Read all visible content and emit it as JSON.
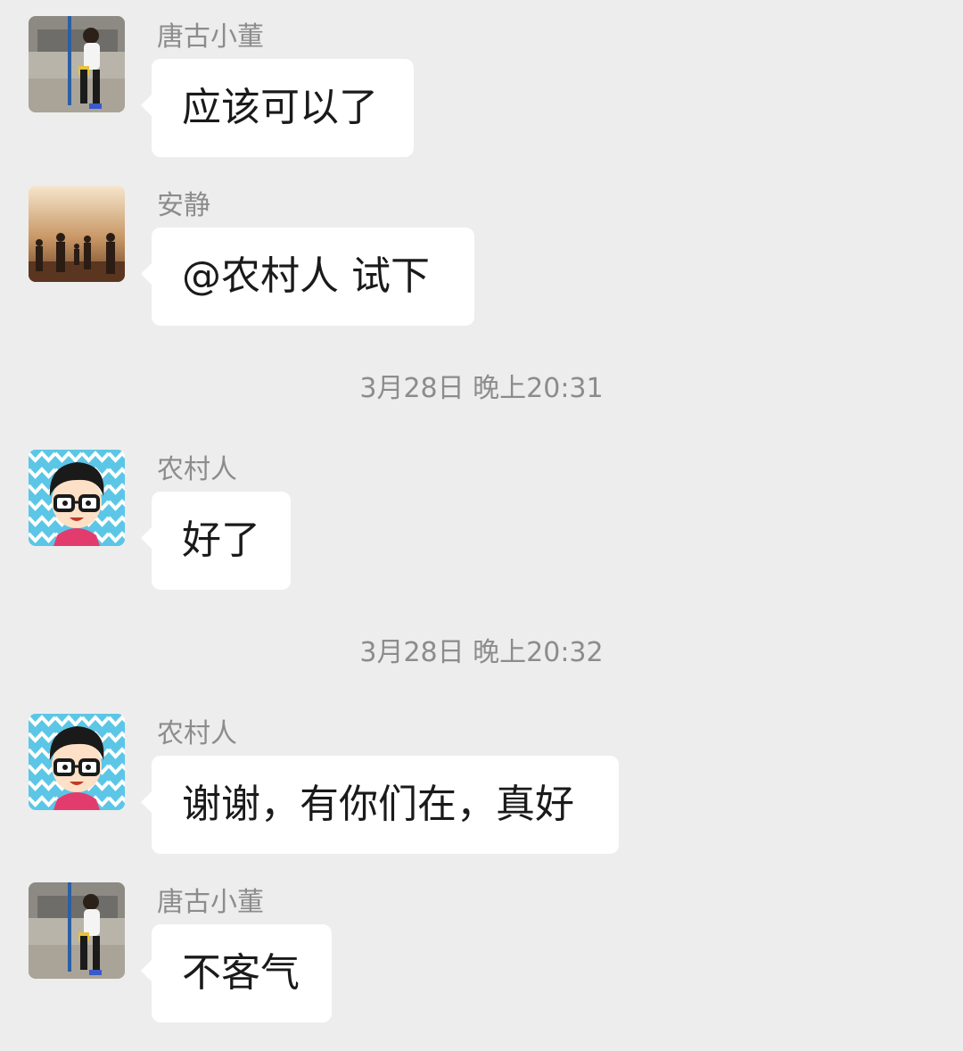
{
  "messages": [
    {
      "sender": "唐古小董",
      "text": "应该可以了",
      "avatar": "boy-photo-avatar"
    },
    {
      "sender": "安静 ",
      "text": "@农村人  试下",
      "avatar": "band-photo-avatar"
    },
    {
      "sender": "农村人",
      "text": "好了",
      "avatar": "cartoon-glasses-avatar"
    },
    {
      "sender": "农村人",
      "text": "谢谢，有你们在，真好",
      "avatar": "cartoon-glasses-avatar"
    },
    {
      "sender": "唐古小董",
      "text": "不客气",
      "avatar": "boy-photo-avatar"
    }
  ],
  "timestamps": [
    "3月28日 晚上20:31",
    "3月28日 晚上20:32"
  ],
  "colors": {
    "background": "#ededed",
    "bubble": "#ffffff",
    "meta_text": "#8c8c8c",
    "message_text": "#1a1a1a"
  }
}
